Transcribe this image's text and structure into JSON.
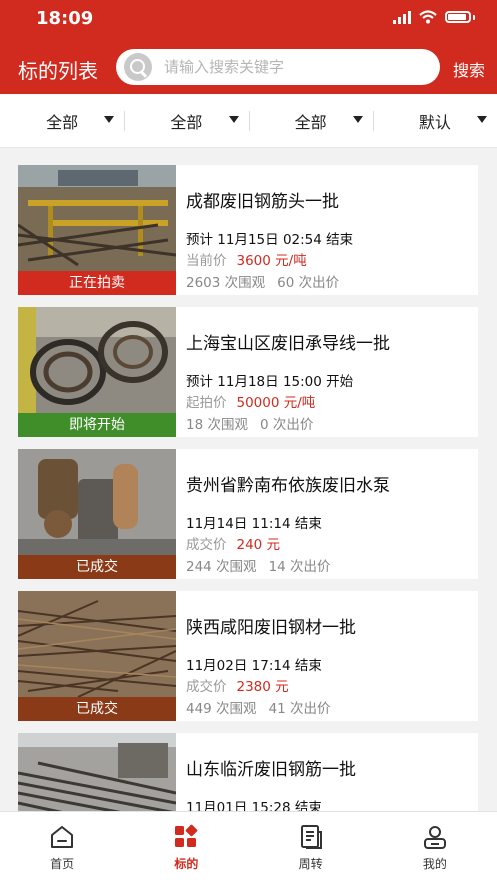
{
  "status_bar": {
    "time": "18:09"
  },
  "header": {
    "title": "标的列表",
    "search_placeholder": "请输入搜索关键字",
    "search_button": "搜索"
  },
  "filters": [
    {
      "label": "全部"
    },
    {
      "label": "全部"
    },
    {
      "label": "全部"
    },
    {
      "label": "默认"
    }
  ],
  "colors": {
    "brand": "#d12b1f",
    "status_auction": "#d12b1f",
    "status_upcoming": "#3f8e2a",
    "status_done": "#8b3a17"
  },
  "items": [
    {
      "status": "正在拍卖",
      "title": "成都废旧钢筋头一批",
      "time": "预计 11月15日 02:54 结束",
      "price_label": "当前价",
      "price": "3600 元/吨",
      "views": "2603 次围观",
      "bids": "60 次出价"
    },
    {
      "status": "即将开始",
      "title": "上海宝山区废旧承导线一批",
      "time": "预计 11月18日 15:00 开始",
      "price_label": "起拍价",
      "price": "50000 元/吨",
      "views": "18 次围观",
      "bids": "0 次出价"
    },
    {
      "status": "已成交",
      "title": "贵州省黔南布依族废旧水泵",
      "time": "11月14日 11:14 结束",
      "price_label": "成交价",
      "price": "240 元",
      "views": "244 次围观",
      "bids": "14 次出价"
    },
    {
      "status": "已成交",
      "title": "陕西咸阳废旧钢材一批",
      "time": "11月02日 17:14 结束",
      "price_label": "成交价",
      "price": "2380 元",
      "views": "449 次围观",
      "bids": "41 次出价"
    },
    {
      "status": "",
      "title": "山东临沂废旧钢筋一批",
      "time": "11月01日 15:28 结束",
      "price_label": "",
      "price": "",
      "views": "",
      "bids": ""
    }
  ],
  "tabs": [
    {
      "label": "首页",
      "icon": "home-icon"
    },
    {
      "label": "标的",
      "icon": "grid-icon",
      "active": true
    },
    {
      "label": "周转",
      "icon": "document-icon"
    },
    {
      "label": "我的",
      "icon": "user-icon"
    }
  ]
}
